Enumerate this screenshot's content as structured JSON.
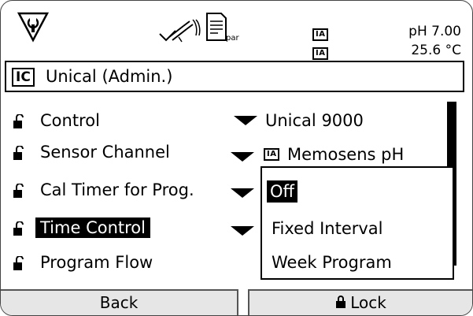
{
  "status": {
    "indicators": [
      "IA",
      "IA"
    ],
    "ph_value": "pH 7.00",
    "temperature": "25.6 °C",
    "doc_icon_text": "par"
  },
  "mode_bar": {
    "badge": "IC",
    "title": "Unical (Admin.)"
  },
  "menu": [
    {
      "label": "Control",
      "value": "Unical 9000"
    },
    {
      "label": "Sensor Channel",
      "value_badge": "IA",
      "value": "Memosens pH"
    },
    {
      "label": "Cal Timer for Prog.",
      "value": ""
    },
    {
      "label": "Time Control",
      "value": ""
    },
    {
      "label": "Program Flow",
      "value": ""
    }
  ],
  "dropdown": {
    "options": [
      "Off",
      "Fixed Interval",
      "Week Program"
    ],
    "selected": "Off"
  },
  "softkeys": {
    "left": "Back",
    "right": "Lock"
  }
}
